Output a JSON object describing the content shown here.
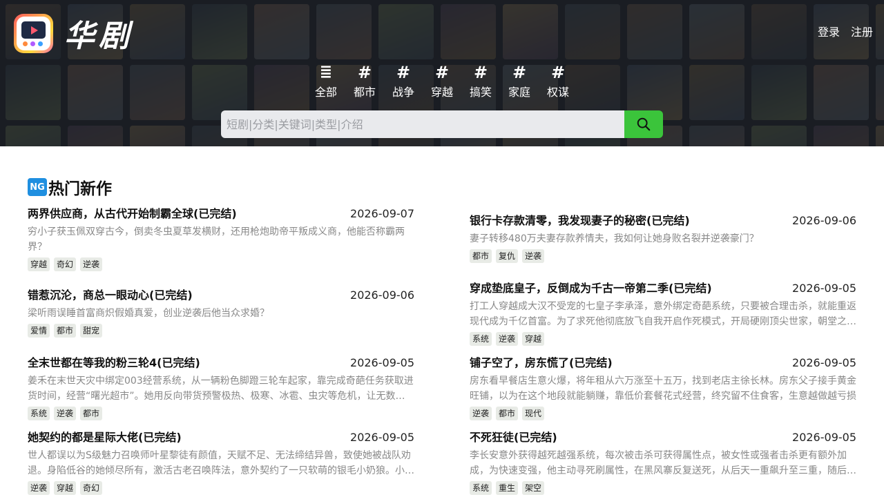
{
  "brand": {
    "name": "华剧"
  },
  "auth": {
    "login": "登录",
    "register": "注册"
  },
  "categories": [
    {
      "icon": "list-icon",
      "glyph": "≣",
      "label": "全部"
    },
    {
      "icon": "hash-icon",
      "glyph": "#",
      "label": "都市"
    },
    {
      "icon": "hash-icon",
      "glyph": "#",
      "label": "战争"
    },
    {
      "icon": "hash-icon",
      "glyph": "#",
      "label": "穿越"
    },
    {
      "icon": "hash-icon",
      "glyph": "#",
      "label": "搞笑"
    },
    {
      "icon": "hash-icon",
      "glyph": "#",
      "label": "家庭"
    },
    {
      "icon": "hash-icon",
      "glyph": "#",
      "label": "权谋"
    }
  ],
  "search": {
    "placeholder": "短剧|分类|关键词|类型|介绍"
  },
  "section": {
    "badge": "NG",
    "title": "热门新作"
  },
  "colors": {
    "accent": "#3bc43b",
    "badge": "#1f8fe0",
    "tag_bg": "#e8ebe6"
  },
  "items": [
    {
      "title": "两界供应商，从古代开始制霸全球(已完结)",
      "date": "2026-09-07",
      "desc": "穷小子获玉佩双穿古今，倒卖冬虫夏草发横财，还用枪炮助帝平叛成义商，他能否称霸两界？",
      "tags": [
        "穿越",
        "奇幻",
        "逆袭"
      ]
    },
    {
      "title": "银行卡存款清零，我发现妻子的秘密(已完结)",
      "date": "2026-09-06",
      "desc": "妻子转移480万夫妻存款养情夫，我如何让她身败名裂并逆袭豪门？",
      "tags": [
        "都市",
        "复仇",
        "逆袭"
      ]
    },
    {
      "title": "错惹沉沦，商总一眼动心(已完结)",
      "date": "2026-09-06",
      "desc": "梁听雨误睡首富商炽假婚真爱，创业逆袭后他当众求婚？",
      "tags": [
        "爱情",
        "都市",
        "甜宠"
      ]
    },
    {
      "title": "穿成垫底皇子，反倒成为千古一帝第二季(已完结)",
      "date": "2026-09-05",
      "desc": "打工人穿越成大汉不受宠的七皇子李承泽，意外绑定奇葩系统，只要被合理击杀，就能重返现代成为千亿首富。为了求死他彻底放飞自我开启作死模式，开局硬刚顶尖世家，朝堂之上怒斥权臣",
      "tags": [
        "系统",
        "逆袭",
        "穿越"
      ]
    },
    {
      "title": "全末世都在等我的粉三轮4(已完结)",
      "date": "2026-09-05",
      "desc": "姜禾在末世天灾中绑定003经营系统，从一辆粉色脚蹬三轮车起家，靠完成奇葩任务获取进货时间，经营“曙光超市”。她用反向带货预警极热、极寒、冰雹、虫灾等危机，让无数幸存者活了下来",
      "tags": [
        "系统",
        "逆袭",
        "都市"
      ]
    },
    {
      "title": "铺子空了，房东慌了(已完结)",
      "date": "2026-09-05",
      "desc": "房东看早餐店生意火爆，将年租从六万涨至十五万，找到老店主徐长林。房东父子接手黄金旺铺，以为在这个地段就能躺赚，靠低价套餐花式经营，终究留不住食客，生意越做越亏损",
      "tags": [
        "逆袭",
        "都市",
        "现代"
      ]
    },
    {
      "title": "她契约的都是星际大佬(已完结)",
      "date": "2026-09-05",
      "desc": "世人都误以为S级魅力召唤师叶星黎徒有颜值，天赋不足、无法缔结异兽，致使她被战队劝退。身陷低谷的她倾尽所有，激活古老召唤阵法，意外契约了一只软萌的银毛小奶狼。小奶狼竟是星际大佬",
      "tags": [
        "逆袭",
        "穿越",
        "奇幻"
      ]
    },
    {
      "title": "不死狂徒(已完结)",
      "date": "2026-09-05",
      "desc": "李长安意外获得越死越强系统，每次被击杀可获得属性点，被女性或强者击杀更有额外加成，为快速变强，他主动寻死刷属性，在黑风寨反复送死，从后天一重飙升至三重，随后一路高歌猛进",
      "tags": [
        "系统",
        "重生",
        "架空"
      ]
    }
  ]
}
